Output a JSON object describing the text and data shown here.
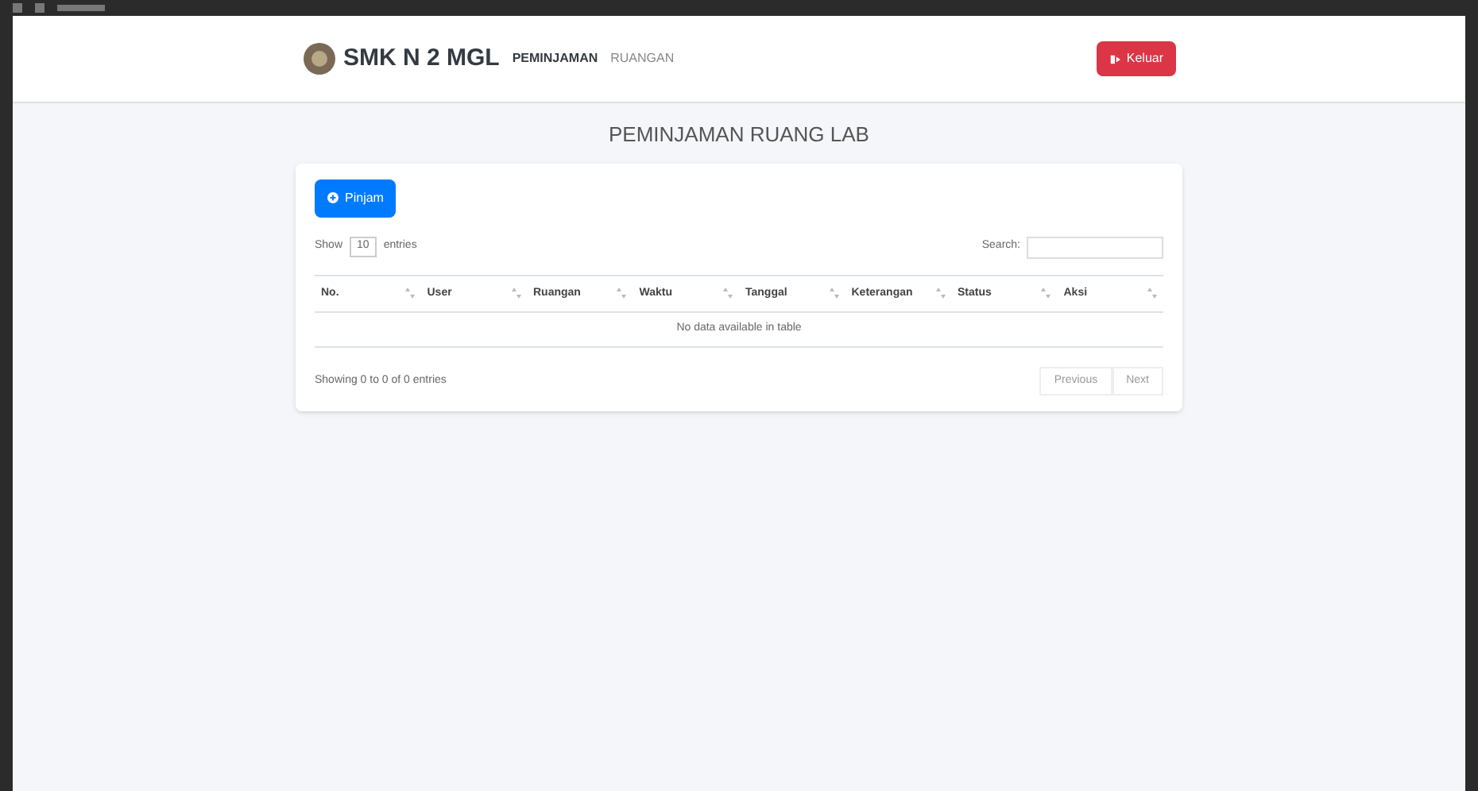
{
  "navbar": {
    "brand": "SMK N 2 MGL",
    "links": [
      {
        "label": "PEMINJAMAN",
        "selected": true
      },
      {
        "label": "RUANGAN",
        "selected": false
      }
    ],
    "logout": "Keluar"
  },
  "title": "PEMINJAMAN RUANG LAB",
  "add_button": "Pinjam",
  "length": {
    "prefix": "Show",
    "value": "10",
    "suffix": "entries"
  },
  "search": {
    "label": "Search:"
  },
  "table": {
    "columns": [
      "No.",
      "User",
      "Ruangan",
      "Waktu",
      "Tanggal",
      "Keterangan",
      "Status",
      "Aksi"
    ],
    "empty": "No data available in table"
  },
  "info": "Showing 0 to 0 of 0 entries",
  "pagination": [
    "Previous",
    "Next"
  ]
}
